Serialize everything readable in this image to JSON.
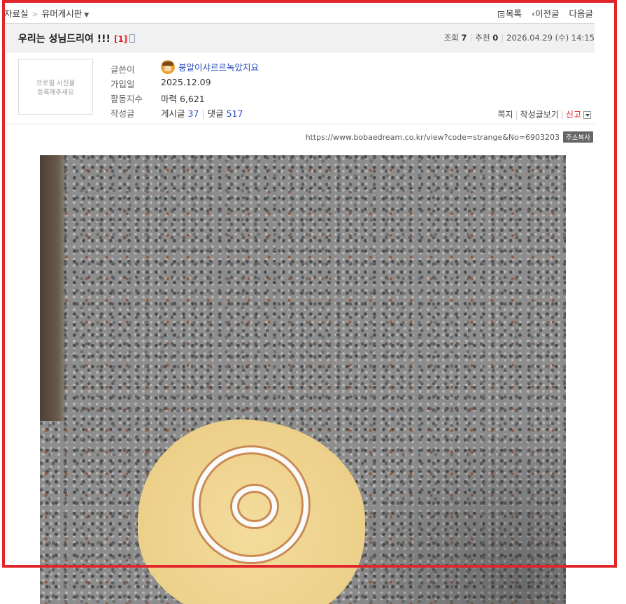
{
  "breadcrumb": {
    "section": "자료실",
    "board": "유머게시판"
  },
  "topnav": {
    "list": "목록",
    "prev": "이전글",
    "next": "다음글"
  },
  "post": {
    "title": "우리는 성님드리여 !!!",
    "comment_count": "[1]",
    "views_label": "조회",
    "views": "7",
    "recommend_label": "추천",
    "recommend": "0",
    "datetime": "2026.04.29 (수) 14:15"
  },
  "author": {
    "profile_placeholder_line1": "프로필 사진을",
    "profile_placeholder_line2": "등록해주세요",
    "writer_label": "글쓴이",
    "writer": "붕알이샤르르녹았지요",
    "joined_label": "가입일",
    "joined": "2025.12.09",
    "activity_label": "활동지수",
    "activity": "마력 6,621",
    "posts_label": "작성글",
    "posts_prefix": "게시글",
    "posts_count": "37",
    "comments_prefix": "댓글",
    "comments_count": "517"
  },
  "actions": {
    "message": "쪽지",
    "view_posts": "작성글보기",
    "report": "신고"
  },
  "url": {
    "text": "https://www.bobaedream.co.kr/view?code=strange&No=6903203",
    "copy_label": "주소복사"
  },
  "colors": {
    "highlight": "#e2242b",
    "accent_red": "#e0252a",
    "link_blue": "#2a4bbf"
  }
}
